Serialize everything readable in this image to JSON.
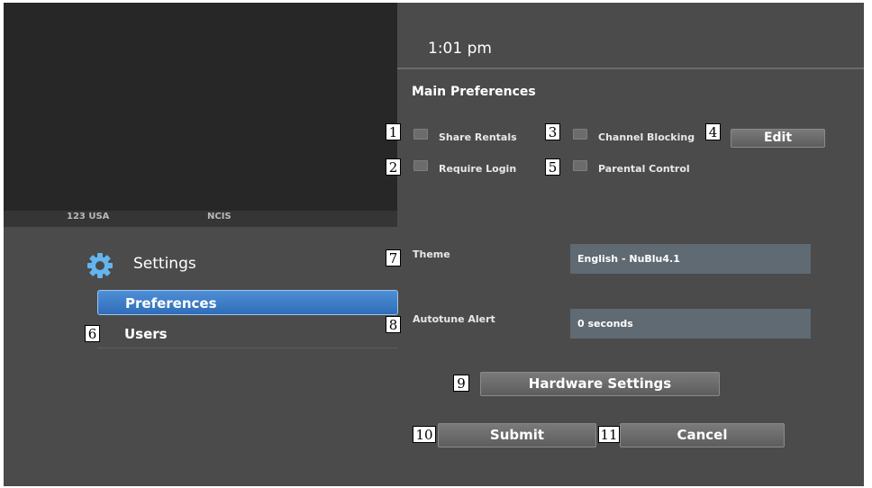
{
  "status": {
    "time": "1:01 pm"
  },
  "video": {
    "channel_number": "123 USA",
    "program": "NCIS"
  },
  "sidebar": {
    "title": "Settings",
    "items": [
      {
        "label": "Preferences",
        "selected": true
      },
      {
        "label": "Users",
        "selected": false
      }
    ]
  },
  "main": {
    "section_title": "Main Preferences",
    "checkboxes": {
      "share_rentals": "Share Rentals",
      "require_login": "Require Login",
      "channel_blocking": "Channel Blocking",
      "parental_control": "Parental Control"
    },
    "edit_label": "Edit",
    "theme_label": "Theme",
    "theme_value": "English - NuBlu4.1",
    "autotune_label": "Autotune Alert",
    "autotune_value": "0 seconds",
    "hardware_label": "Hardware Settings",
    "submit_label": "Submit",
    "cancel_label": "Cancel"
  },
  "callouts": [
    "1",
    "2",
    "3",
    "4",
    "5",
    "6",
    "7",
    "8",
    "9",
    "10",
    "11"
  ],
  "colors": {
    "accent": "#3a7cc8",
    "background": "#4b4b4b",
    "field": "#5f6a72"
  },
  "icons": {
    "settings": "gear-icon"
  }
}
